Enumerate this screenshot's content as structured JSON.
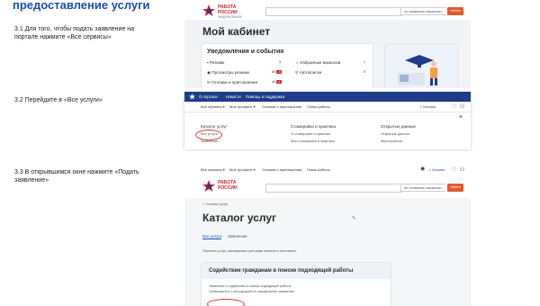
{
  "heading": "предоставление услуги",
  "steps": {
    "s1": "3.1 Для того, чтобы подать заявление на портале нажмите «Все сервисы»",
    "s2": "3.2 Перейдите в «Все услуги»",
    "s3": "3.3 В открывшимся окне нажмите «Подать заявление»"
  },
  "logo": {
    "line1": "РАБОТА",
    "line2": "РОССИИ",
    "sub": "ФЕДЕРАЛЬНАЯ"
  },
  "search": {
    "select_label": "по названию вакансии",
    "button": "Найти"
  },
  "cabinet": {
    "title": "Мой кабинет",
    "notifications_title": "Уведомления и события",
    "items": [
      {
        "label": "Резюме",
        "count": "3"
      },
      {
        "label": "Избранные вакансии",
        "count": "1"
      },
      {
        "label": "Просмотры резюме",
        "count": "69"
      },
      {
        "label": "Автопоиски",
        "count": "0"
      },
      {
        "label": "Отклики и приглашения",
        "count": "40"
      }
    ],
    "badges": {
      "views": "+5",
      "responses": "+1"
    }
  },
  "topnav": {
    "items": [
      "О портале",
      "Новости",
      "Помощь и поддержка"
    ]
  },
  "subnav": {
    "items": [
      "Все сервисы ▾",
      "Мое профиль ▾",
      "Отклики и приглашения",
      "Поиск работы"
    ],
    "moscow": "г. Москва"
  },
  "menu": {
    "columns": [
      {
        "head": "Каталог услуг",
        "items": [
          "Все услуги",
          "Заявления"
        ]
      },
      {
        "head": "Стажировка и практика",
        "items": [
          "О стажировке и практике",
          "Мои стажировки и практики"
        ]
      },
      {
        "head": "Открытые данные",
        "items": [
          "Открытые данные",
          "Мероприятия"
        ]
      }
    ],
    "close": "×"
  },
  "subnav3": {
    "items": [
      "Все сервисы ▾",
      "Мое профиль ▾",
      "Отклики и приглашения",
      "Поиск работы"
    ],
    "moscow": "г. Москва"
  },
  "catalog": {
    "breadcrumb": "⌂ › Каталог услуг",
    "title": "Каталог услуг",
    "tabs": [
      "Все услуги",
      "Заявления"
    ],
    "info": "Перечень услуг, оказываемых центрами занятости населения.",
    "service_title": "Содействие гражданам в поиске подходящей работы",
    "service_desc1": "Заявление о содействии в поиске подходящей работы.",
    "service_desc2": "Ознакомьтесь с инструкцией по оформлению заявления."
  },
  "colors": {
    "brand_red": "#d51e2b",
    "nav_blue": "#1f3c88",
    "heading_blue": "#1a4fb4",
    "button_orange": "#e05a2b"
  }
}
